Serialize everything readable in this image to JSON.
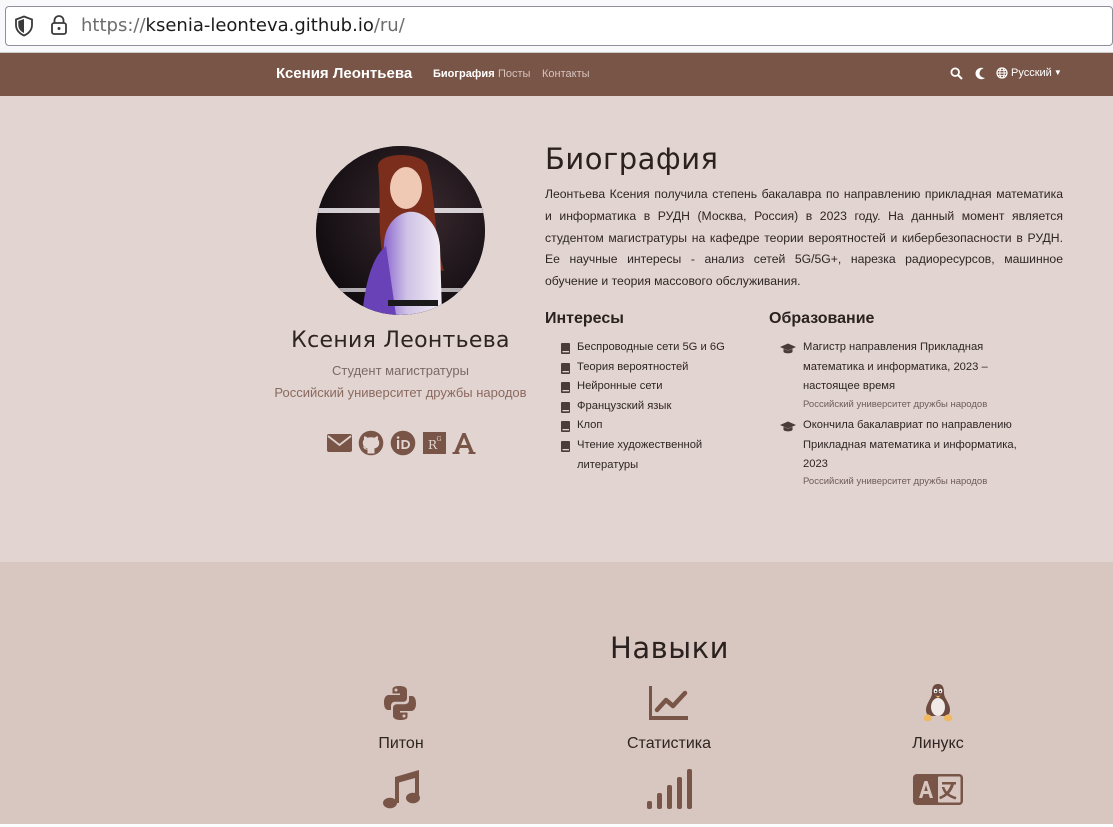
{
  "browser": {
    "url_scheme": "https://",
    "url_host": "ksenia-leonteva.github.io",
    "url_path": "/ru/"
  },
  "navbar": {
    "brand": "Ксения Леонтьева",
    "links": [
      "Биография",
      "Посты",
      "Контакты"
    ],
    "language": "Русский"
  },
  "profile": {
    "name": "Ксения Леонтьева",
    "role": "Студент магистратуры",
    "organization": "Российский университет дружбы народов",
    "social_icons": [
      "envelope-icon",
      "github-icon",
      "orcid-icon",
      "researchgate-icon",
      "academia-icon"
    ]
  },
  "biography": {
    "title": "Биография",
    "text": "Леонтьева Ксения получила степень бакалавра по направлению прикладная математика и информатика в РУДН (Москва, Россия) в 2023 году. На данный момент является студентом магистратуры на кафедре теории вероятностей и кибербезопасности в РУДН. Ее научные интересы - анализ сетей 5G/5G+, нарезка радиоресурсов, машинное обучение и теория массового обслуживания."
  },
  "interests": {
    "title": "Интересы",
    "items": [
      "Беспроводные сети 5G и 6G",
      "Теория вероятностей",
      "Нейронные сети",
      "Французский язык",
      "Клоп",
      "Чтение художественной литературы"
    ]
  },
  "education": {
    "title": "Образование",
    "items": [
      {
        "degree": "Магистр направления Прикладная математика и информатика, 2023 – настоящее время",
        "institution": "Российский университет дружбы народов"
      },
      {
        "degree": "Окончила бакалавриат по направлению Прикладная математика и информатика, 2023",
        "institution": "Российский университет дружбы народов"
      }
    ]
  },
  "skills": {
    "title": "Навыки",
    "items": [
      {
        "label": "Питон",
        "icon": "python-icon"
      },
      {
        "label": "Статистика",
        "icon": "chart-line-icon"
      },
      {
        "label": "Линукс",
        "icon": "linux-icon"
      },
      {
        "label": "",
        "icon": "music-icon"
      },
      {
        "label": "",
        "icon": "signal-icon"
      },
      {
        "label": "",
        "icon": "language-icon"
      }
    ]
  },
  "colors": {
    "navbar": "#795548",
    "bio_background": "#e2d4d1",
    "skills_background": "#d8c6c1",
    "icon": "#795548"
  }
}
